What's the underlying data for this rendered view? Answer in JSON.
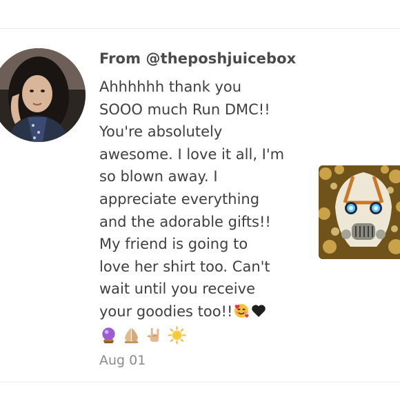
{
  "message": {
    "from_label": "From @theposhjuicebox",
    "lines": [
      "Ahhhhhh thank you",
      "SOOO much Run DMC!!",
      "You're absolutely",
      "awesome. I love it all, I'm",
      "so blown away. I",
      "appreciate everything",
      "and the adorable gifts!!",
      "My friend is going to",
      "love her shirt too. Can't",
      "wait until you receive",
      "your goodies too!!"
    ],
    "inline_emojis": [
      "smiling-face-with-hearts",
      "black-heart"
    ],
    "emoji_row": [
      "crystal-ball",
      "folded-hands",
      "sign-of-the-horns",
      "sun"
    ],
    "date": "Aug 01"
  },
  "avatar": {
    "icon": "user-avatar-photo"
  },
  "thumbnail": {
    "icon": "golden-mask-artwork"
  }
}
